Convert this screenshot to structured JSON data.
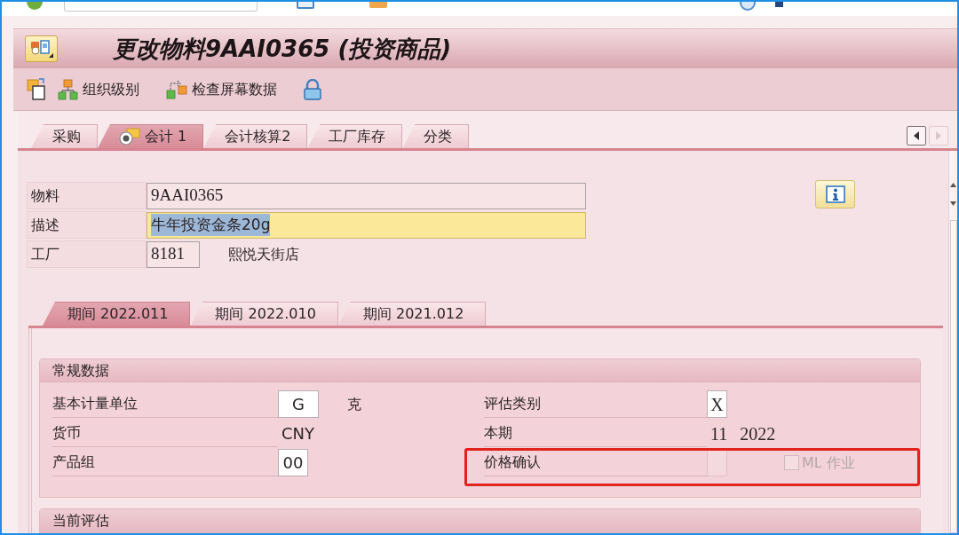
{
  "window": {
    "title": "更改物料9AAI0365 (投资商品)"
  },
  "toolbar": [
    {
      "label": "组织级别"
    },
    {
      "label": "检查屏幕数据"
    }
  ],
  "tabs": [
    {
      "label": "采购",
      "selected": false
    },
    {
      "label": "会计 1",
      "selected": true
    },
    {
      "label": "会计核算2",
      "selected": false
    },
    {
      "label": "工厂库存",
      "selected": false
    },
    {
      "label": "分类",
      "selected": false
    }
  ],
  "tab_scroll": [
    {
      "disabled": false
    },
    {
      "disabled": true
    }
  ],
  "header": {
    "fields": [
      {
        "label": "物料",
        "kind": "wide",
        "value": "9AAI0365",
        "focused": false,
        "text_selected": false
      },
      {
        "label": "描述",
        "kind": "wide",
        "value": "牛年投资金条20g",
        "focused": true,
        "text_selected": true
      },
      {
        "label": "工厂",
        "kind": "narrow",
        "value": "8181",
        "text": "熙悦天街店",
        "focused": false,
        "text_selected": false
      }
    ]
  },
  "period_tabs": [
    {
      "label": "期间 2022.011",
      "selected": true
    },
    {
      "label": "期间 2022.010",
      "selected": false
    },
    {
      "label": "期间 2021.012",
      "selected": false
    }
  ],
  "general_data": {
    "title": "常规数据",
    "rows": [
      {
        "cells": [
          {
            "kind": "input",
            "label": "基本计量单位",
            "value": "G",
            "text": "克",
            "disabled": false,
            "highlighted": false
          },
          {
            "kind": "input",
            "label": "评估类别",
            "value": "X",
            "disabled": false,
            "highlighted": false
          }
        ]
      },
      {
        "cells": [
          {
            "kind": "display",
            "label": "货币",
            "values": [
              "CNY"
            ],
            "highlighted": false
          },
          {
            "kind": "display",
            "label": "本期",
            "values": [
              "11",
              "2022"
            ],
            "highlighted": false
          }
        ]
      },
      {
        "cells": [
          {
            "kind": "input",
            "label": "产品组",
            "value": "00",
            "disabled": false,
            "highlighted": false
          },
          {
            "kind": "input",
            "label": "价格确认",
            "disabled": true,
            "highlighted": true,
            "checkbox": {
              "label": "ML 作业",
              "checked": false,
              "disabled": true
            }
          }
        ]
      }
    ]
  },
  "current_valuation": {
    "title": "当前评估"
  }
}
